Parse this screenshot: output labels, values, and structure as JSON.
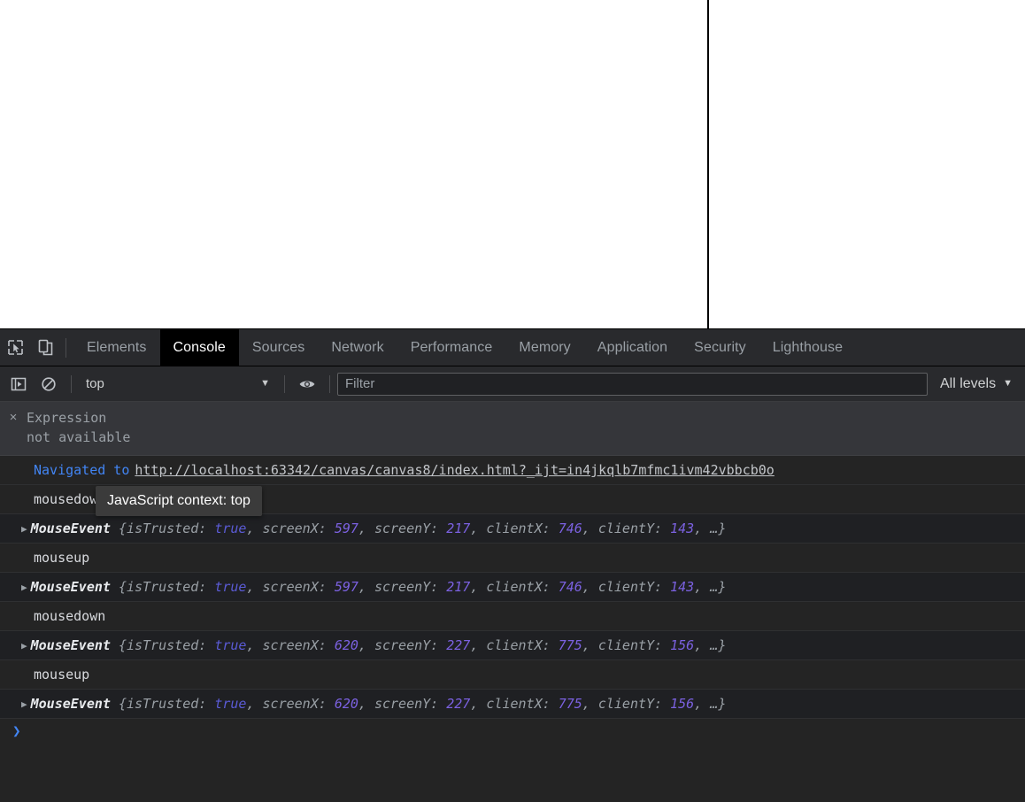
{
  "page": {
    "background": "#ffffff",
    "divider_line_color": "#000000"
  },
  "devtools": {
    "toolbar_icons": {
      "inspect": "inspect-element-icon",
      "device": "device-toolbar-icon"
    },
    "tabs": [
      {
        "label": "Elements",
        "selected": false
      },
      {
        "label": "Console",
        "selected": true
      },
      {
        "label": "Sources",
        "selected": false
      },
      {
        "label": "Network",
        "selected": false
      },
      {
        "label": "Performance",
        "selected": false
      },
      {
        "label": "Memory",
        "selected": false
      },
      {
        "label": "Application",
        "selected": false
      },
      {
        "label": "Security",
        "selected": false
      },
      {
        "label": "Lighthouse",
        "selected": false
      }
    ],
    "filterbar": {
      "sidebar_toggle_icon": "console-sidebar-icon",
      "clear_console_icon": "clear-console-icon",
      "context": "top",
      "context_caret": "▼",
      "eye_icon": "live-expression-eye-icon",
      "filter_value": "",
      "filter_placeholder": "Filter",
      "levels": "All levels",
      "levels_caret": "▼"
    },
    "tooltip": {
      "text": "JavaScript context: top"
    },
    "banner": {
      "close": "×",
      "line1": "Expression",
      "line2": "not available"
    },
    "messages": [
      {
        "kind": "navigated",
        "label": "Navigated to",
        "url": "http://localhost:63342/canvas/canvas8/index.html?_ijt=in4jkqlb7mfmc1ivm42vbbcb0o"
      },
      {
        "kind": "text",
        "text": "mousedown"
      },
      {
        "kind": "object",
        "arrow": "▶",
        "class": "MouseEvent",
        "open_brace": "{",
        "props": [
          {
            "key": "isTrusted:",
            "value": "true",
            "type": "bool"
          },
          {
            "key": "screenX:",
            "value": "597",
            "type": "num"
          },
          {
            "key": "screenY:",
            "value": "217",
            "type": "num"
          },
          {
            "key": "clientX:",
            "value": "746",
            "type": "num"
          },
          {
            "key": "clientY:",
            "value": "143",
            "type": "num"
          }
        ],
        "ellipsis": "…",
        "close_brace": "}"
      },
      {
        "kind": "text",
        "text": "mouseup"
      },
      {
        "kind": "object",
        "arrow": "▶",
        "class": "MouseEvent",
        "open_brace": "{",
        "props": [
          {
            "key": "isTrusted:",
            "value": "true",
            "type": "bool"
          },
          {
            "key": "screenX:",
            "value": "597",
            "type": "num"
          },
          {
            "key": "screenY:",
            "value": "217",
            "type": "num"
          },
          {
            "key": "clientX:",
            "value": "746",
            "type": "num"
          },
          {
            "key": "clientY:",
            "value": "143",
            "type": "num"
          }
        ],
        "ellipsis": "…",
        "close_brace": "}"
      },
      {
        "kind": "text",
        "text": "mousedown"
      },
      {
        "kind": "object",
        "arrow": "▶",
        "class": "MouseEvent",
        "open_brace": "{",
        "props": [
          {
            "key": "isTrusted:",
            "value": "true",
            "type": "bool"
          },
          {
            "key": "screenX:",
            "value": "620",
            "type": "num"
          },
          {
            "key": "screenY:",
            "value": "227",
            "type": "num"
          },
          {
            "key": "clientX:",
            "value": "775",
            "type": "num"
          },
          {
            "key": "clientY:",
            "value": "156",
            "type": "num"
          }
        ],
        "ellipsis": "…",
        "close_brace": "}"
      },
      {
        "kind": "text",
        "text": "mouseup"
      },
      {
        "kind": "object",
        "arrow": "▶",
        "class": "MouseEvent",
        "open_brace": "{",
        "props": [
          {
            "key": "isTrusted:",
            "value": "true",
            "type": "bool"
          },
          {
            "key": "screenX:",
            "value": "620",
            "type": "num"
          },
          {
            "key": "screenY:",
            "value": "227",
            "type": "num"
          },
          {
            "key": "clientX:",
            "value": "775",
            "type": "num"
          },
          {
            "key": "clientY:",
            "value": "156",
            "type": "num"
          }
        ],
        "ellipsis": "…",
        "close_brace": "}"
      }
    ],
    "prompt": {
      "caret": "❯"
    }
  }
}
